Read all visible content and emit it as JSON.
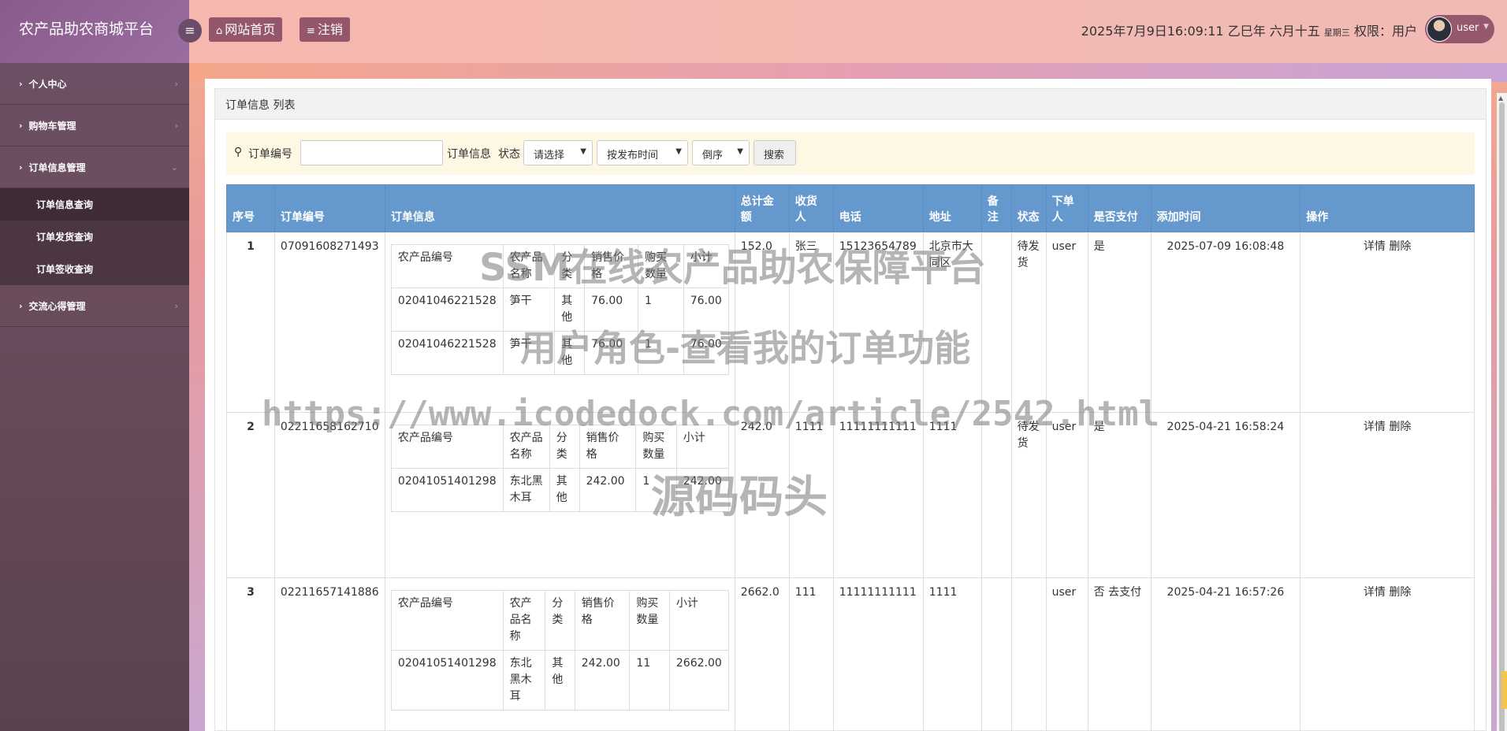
{
  "sidebar": {
    "brand": "农产品助农商城平台",
    "items": [
      {
        "label": "个人中心"
      },
      {
        "label": "购物车管理"
      },
      {
        "label": "订单信息管理"
      },
      {
        "label": "交流心得管理"
      }
    ],
    "submenu": [
      "订单信息查询",
      "订单发货查询",
      "订单签收查询"
    ]
  },
  "header": {
    "home_label": "网站首页",
    "logout_label": "注销",
    "datetime": "2025年7月9日16:09:11 乙巳年 六月十五",
    "weekday": "星期三",
    "role": "权限：用户",
    "user": "user"
  },
  "card_title": "订单信息 列表",
  "search": {
    "order_no_label": "订单编号",
    "order_info_label": "订单信息",
    "status_label": "状态",
    "status_select": "请选择",
    "sort_select": "按发布时间",
    "order_select": "倒序",
    "search_button": "搜索"
  },
  "table": {
    "headers": [
      "序号",
      "订单编号",
      "订单信息",
      "总计金额",
      "收货人",
      "电话",
      "地址",
      "备注",
      "状态",
      "下单人",
      "是否支付",
      "添加时间",
      "操作"
    ],
    "inner_headers": [
      "农产品编号",
      "农产品名称",
      "分类",
      "销售价格",
      "购买数量",
      "小计"
    ],
    "rows": [
      {
        "idx": "1",
        "order_no": "07091608271493",
        "items": [
          [
            "02041046221528",
            "笋干",
            "其他",
            "76.00",
            "1",
            "76.00"
          ],
          [
            "02041046221528",
            "笋干",
            "其他",
            "76.00",
            "1",
            "76.00"
          ]
        ],
        "total": "152.0",
        "receiver": "张三",
        "phone": "15123654789",
        "address": "北京市大同区",
        "note": "",
        "status": "待发货",
        "buyer": "user",
        "paid": "是",
        "pay_link": "",
        "time": "2025-07-09 16:08:48"
      },
      {
        "idx": "2",
        "order_no": "02211658162710",
        "items": [
          [
            "02041051401298",
            "东北黑木耳",
            "其他",
            "242.00",
            "1",
            "242.00"
          ]
        ],
        "total": "242.0",
        "receiver": "1111",
        "phone": "11111111111",
        "address": "1111",
        "note": "",
        "status": "待发货",
        "buyer": "user",
        "paid": "是",
        "pay_link": "",
        "time": "2025-04-21 16:58:24"
      },
      {
        "idx": "3",
        "order_no": "02211657141886",
        "items": [
          [
            "02041051401298",
            "东北黑木耳",
            "其他",
            "242.00",
            "11",
            "2662.00"
          ]
        ],
        "total": "2662.0",
        "receiver": "111",
        "phone": "11111111111",
        "address": "1111",
        "note": "",
        "status": "",
        "buyer": "user",
        "paid": "否",
        "pay_link": "去支付",
        "time": "2025-04-21 16:57:26"
      }
    ],
    "op_detail": "详情",
    "op_delete": "删除"
  },
  "watermark": {
    "line1": "SSM在线农产品助农保障平台",
    "line2": "用户角色-查看我的订单功能",
    "line3": "https://www.icodedock.com/article/2542.html",
    "line4": "源码码头"
  },
  "colors": {
    "header_blue": "#6598cd",
    "header_button": "#93566b",
    "sidebar": "#6d5066",
    "search_bg": "#fcf8e3"
  }
}
